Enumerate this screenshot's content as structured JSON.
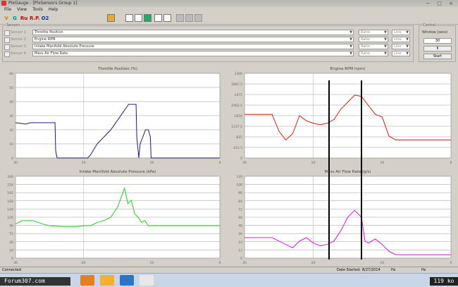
{
  "window": {
    "title": "PlxGauge - [PlxSensors Group 1]"
  },
  "menu": [
    "File",
    "View",
    "Tools",
    "Help"
  ],
  "toolbar": [
    "V",
    "G",
    "Ru",
    "R.P.",
    "O2"
  ],
  "sensors": {
    "legend": "Sensors",
    "rows": [
      {
        "label": "Sensor 1",
        "value": "Throttle Position",
        "unit": "Ratio",
        "range": "Line"
      },
      {
        "label": "Sensor 2",
        "value": "Engine RPM",
        "unit": "Ratio",
        "range": "Line"
      },
      {
        "label": "Sensor 3",
        "value": "Intake Manifold Absolute Pressure",
        "unit": "Ratio",
        "range": "Line"
      },
      {
        "label": "Sensor 4",
        "value": "Mass Air Flow Rate",
        "unit": "Ratio",
        "range": "Line"
      }
    ]
  },
  "control": {
    "legend": "Control",
    "label": "Window (secs)",
    "window": "30",
    "pause": "II",
    "start": "Start"
  },
  "chart_data": [
    {
      "type": "line",
      "title": "Throttle Position (%)",
      "color": "#1a1a80",
      "xlim": [
        30,
        0
      ],
      "ylim": [
        0,
        60
      ],
      "xticks": [
        "30",
        "20",
        "10",
        "0"
      ],
      "yticks": [
        "0",
        "10",
        "20",
        "30",
        "40",
        "50",
        "60"
      ],
      "x": [
        30,
        28.5,
        27.8,
        25,
        24.2,
        24.1,
        23.9,
        19.4,
        19,
        18,
        17,
        16,
        13.4,
        12.8,
        12.3,
        12.2,
        11.9,
        11.7,
        10.9,
        10.5,
        10.2,
        10.1,
        9.8,
        0
      ],
      "y": [
        25,
        24,
        25,
        25,
        25,
        5,
        0,
        0,
        2,
        10,
        15,
        20,
        38,
        38,
        38,
        15,
        0,
        10,
        20,
        20,
        15,
        0,
        0,
        0
      ]
    },
    {
      "type": "line",
      "title": "Engine RPM (rpm)",
      "color": "#d02010",
      "xlim": [
        30,
        0
      ],
      "ylim": [
        0,
        3300
      ],
      "xticks": [
        "30",
        "20",
        "10",
        "0"
      ],
      "yticks": [
        "0",
        "412.5",
        "825",
        "1237.5",
        "1650",
        "2062.5",
        "2475",
        "2887.5",
        "3300"
      ],
      "x": [
        30,
        28,
        26,
        25,
        24,
        23,
        22,
        21,
        20,
        19,
        18,
        17,
        16,
        14,
        13,
        12,
        11,
        10,
        9,
        8,
        7,
        6,
        0
      ],
      "y": [
        1700,
        1700,
        1700,
        1050,
        700,
        950,
        1650,
        1450,
        1350,
        1300,
        1350,
        1500,
        1900,
        2450,
        2400,
        2050,
        1700,
        1600,
        850,
        700,
        700,
        700,
        700
      ]
    },
    {
      "type": "line",
      "title": "Intake Manifold Absolute Pressure (kPa)",
      "color": "#20d020",
      "xlim": [
        30,
        0
      ],
      "ylim": [
        0,
        240
      ],
      "xticks": [
        "30",
        "20",
        "10",
        "0"
      ],
      "yticks": [
        "0",
        "24",
        "48",
        "72",
        "96",
        "120",
        "144",
        "168",
        "192",
        "216",
        "240"
      ],
      "x": [
        30,
        29,
        27.5,
        26,
        25,
        23,
        21,
        20,
        19,
        18,
        17,
        16,
        15,
        14,
        13.5,
        13,
        12.5,
        12,
        11.5,
        11,
        10.5,
        10,
        9,
        6,
        0
      ],
      "y": [
        100,
        110,
        110,
        100,
        95,
        92,
        92,
        95,
        95,
        105,
        110,
        120,
        150,
        205,
        160,
        170,
        130,
        120,
        105,
        110,
        95,
        95,
        95,
        95,
        95
      ]
    },
    {
      "type": "line",
      "title": "Mass Air Flow Rate (g/s)",
      "color": "#e010e0",
      "xlim": [
        30,
        0
      ],
      "ylim": [
        0,
        120
      ],
      "xticks": [
        "30",
        "20",
        "10",
        "0"
      ],
      "yticks": [
        "0",
        "12",
        "24",
        "36",
        "48",
        "60",
        "72",
        "84",
        "96",
        "108",
        "120"
      ],
      "x": [
        30,
        28,
        26,
        25,
        24,
        23,
        22,
        21,
        20,
        19,
        18,
        17,
        16,
        15,
        14,
        13,
        12.5,
        12,
        11,
        10,
        9,
        8,
        7,
        0
      ],
      "y": [
        30,
        30,
        30,
        25,
        20,
        15,
        25,
        30,
        22,
        18,
        20,
        25,
        40,
        60,
        70,
        60,
        25,
        22,
        28,
        20,
        10,
        5,
        5,
        5
      ]
    }
  ],
  "status": {
    "left": "Connected",
    "right_label": "Date Started:",
    "date": "8/27/2014",
    "d2": "Hz",
    "d3": "Hz"
  },
  "taskbar": {
    "watermark": "Forum307.com",
    "counter": "119 ko"
  }
}
